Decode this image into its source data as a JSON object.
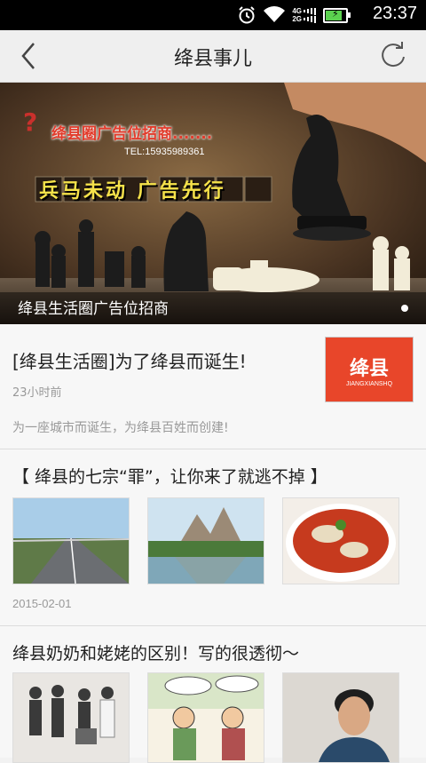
{
  "status_bar": {
    "time": "23:37",
    "network_top": "4G",
    "network_bottom": "2G",
    "icons": [
      "alarm-icon",
      "wifi-icon",
      "signal-4g-icon",
      "signal-2g-icon",
      "battery-charging-icon"
    ],
    "battery_level": 0.9
  },
  "header": {
    "title": "绛县事儿",
    "back_icon": "chevron-left-icon",
    "refresh_icon": "refresh-icon"
  },
  "banner": {
    "caption": "绛县生活圈广告位招商",
    "ad_title": "绛县圈广告位招商.......",
    "ad_tel": "TEL:15935989361",
    "ad_slogan": "兵马未动 广告先行",
    "ad_qmark": "?",
    "slide_count": 1,
    "active_slide": 1
  },
  "articles": [
    {
      "title": "[绛县生活圈]为了绛县而诞生!",
      "time": "23小时前",
      "description": "为一座城市而诞生，为绛县百姓而创建!",
      "thumb_text": "绛县",
      "thumb_subtext": "JIANGXIANSHQ"
    },
    {
      "title": "【 绛县的七宗“罪”，让你来了就逃不掉 】",
      "date": "2015-02-01",
      "images": [
        "highway-photo",
        "mountain-lake-photo",
        "spicy-noodle-dish-photo"
      ]
    },
    {
      "title": "绛县奶奶和姥姥的区别！写的很透彻～",
      "images": [
        "family-group-photo",
        "comic-grandmothers-illustration",
        "woman-portrait-photo"
      ]
    }
  ],
  "colors": {
    "status_bar": "#000000",
    "nav_bar": "#efefef",
    "background": "#f2f2f2",
    "logo_red": "#e8462a"
  }
}
